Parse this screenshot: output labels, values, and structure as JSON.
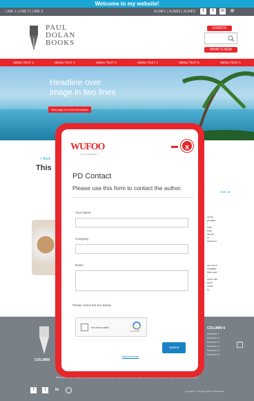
{
  "banner": {
    "text": "Welcome to my website!"
  },
  "top_links": {
    "left": "LINK 1  |  LINK 2  |  LINK 3",
    "right": "XLINK1  |  XLINK2  |  XLINK3"
  },
  "social_icons": [
    "facebook-icon",
    "twitter-icon",
    "linkedin-icon",
    "instagram-icon"
  ],
  "logo": {
    "line1": "PAUL",
    "line2": "DOLAN",
    "line3": "BOOKS"
  },
  "header_buttons": {
    "events": "EVENTS",
    "whats_new": "WHAT'S NEW"
  },
  "nav": {
    "items": [
      "MENU TEXT 1",
      "MENU TEXT 2",
      "MENU TEXT 3",
      "MENU TEXT 4",
      "MENU TEXT 5",
      "MENU TEXT 6"
    ]
  },
  "hero": {
    "line1": "Headline over",
    "line2": "image in two lines",
    "button": "Visit page for more information"
  },
  "article": {
    "back": "< Back",
    "title": "This",
    "right_link": "TIME NE"
  },
  "modal": {
    "brand": "WUFOO",
    "brand_sub": "by SurveyMonkey",
    "form_title": "PD Contact",
    "form_desc": "Please use this form to contact the author.",
    "fields": {
      "your_name": "Your Name",
      "company": "Company",
      "notes": "Notes",
      "check": "Please check the box below."
    },
    "captcha": {
      "label": "I'm not a robot",
      "sub": "reCAPTCHA"
    },
    "submit": "Submit",
    "powered": "Report Abuse"
  },
  "footer": {
    "col1_title": "COLUMN",
    "col2_title": "COLUMN 6",
    "col2_items": [
      "Number 1",
      "Number 2",
      "Number 3",
      "Number 4",
      "Number 5",
      "Number 6"
    ],
    "links": "Bot Line Link 1 | Bot Line Link 2 | Bot Line Link 3 | Bot Line Link 4 | Bot Line Link 5 | Bot Line Link 6 | Bot Line Link 7",
    "copyright": "Copyright © Copyright 2021 by Paul Dolan"
  },
  "colors": {
    "accent": "#e8262b",
    "banner": "#1aa7d8",
    "footer": "#7a8088",
    "submit": "#1a82c4"
  }
}
